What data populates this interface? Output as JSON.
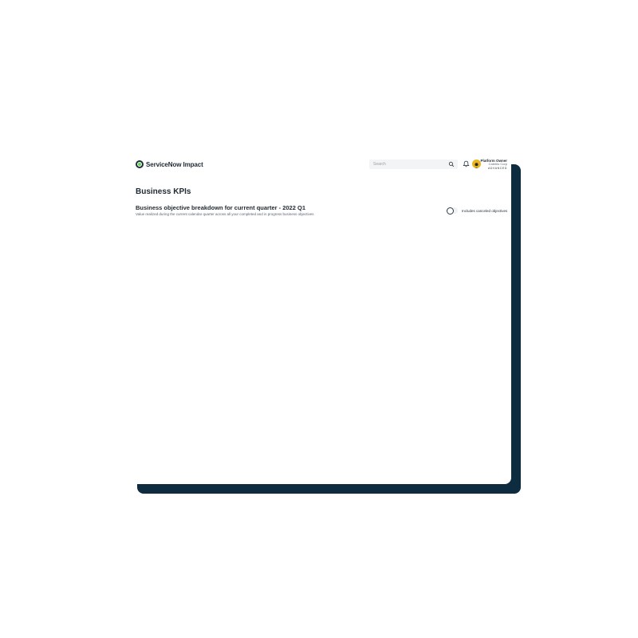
{
  "header": {
    "app_name": "ServiceNow Impact",
    "search": {
      "placeholder": "Search"
    },
    "user": {
      "role": "Platform Owner",
      "company": "Cabrillo Corp",
      "tier": "ADVANCED"
    }
  },
  "main": {
    "page_title": "Business KPIs",
    "section": {
      "title": "Business objective breakdown for current quarter - 2022 Q1",
      "subtitle": "Value realized during the current calendar quarter across all your completed and in progress business objectives"
    },
    "toggle": {
      "label": "Includes canceled objectives",
      "checked": false
    }
  },
  "colors": {
    "panel_shadow": "#0d2c40",
    "logo_green": "#62d84e",
    "avatar_yellow": "#e9b520",
    "text_primary": "#1f2a33"
  },
  "icons": [
    "logo-icon",
    "search-icon",
    "bell-icon",
    "avatar"
  ]
}
